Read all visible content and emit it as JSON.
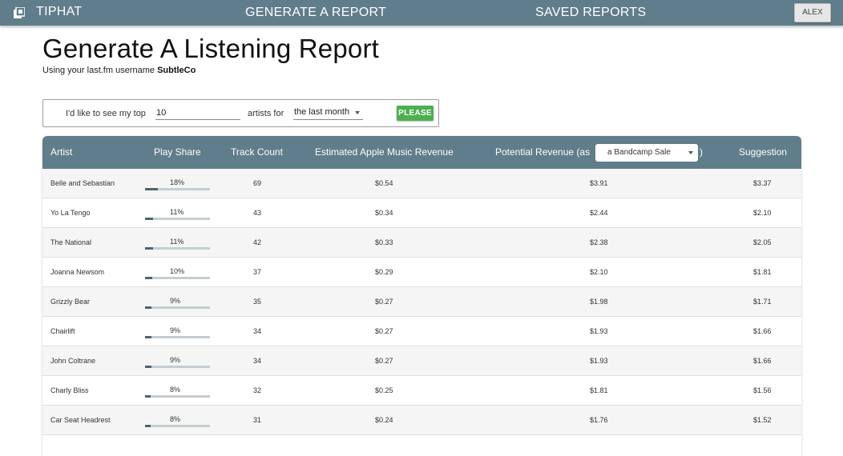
{
  "nav": {
    "brand": "TIPHAT",
    "generate": "GENERATE A REPORT",
    "saved": "SAVED REPORTS",
    "user": "ALEX"
  },
  "page": {
    "title": "Generate A Listening Report",
    "subtitle_prefix": "Using your last.fm username ",
    "username": "SubtleCo"
  },
  "form": {
    "text_before": "I'd like to see my top",
    "count_value": "10",
    "text_middle": "artists for",
    "period_value": "the last month",
    "submit_label": "PLEASE"
  },
  "table": {
    "headers": {
      "artist": "Artist",
      "play_share": "Play Share",
      "track_count": "Track Count",
      "apple_revenue": "Estimated Apple Music Revenue",
      "potential_revenue": "Potential Revenue (as",
      "revenue_mode": "a Bandcamp Sale",
      "paren_close": ")",
      "suggestion": "Suggestion"
    },
    "rows": [
      {
        "artist": "Belle and Sebastian",
        "share": "18%",
        "share_value": 0.18,
        "count": "69",
        "apple": "$0.54",
        "potential": "$3.91",
        "suggestion": "$3.37"
      },
      {
        "artist": "Yo La Tengo",
        "share": "11%",
        "share_value": 0.11,
        "count": "43",
        "apple": "$0.34",
        "potential": "$2.44",
        "suggestion": "$2.10"
      },
      {
        "artist": "The National",
        "share": "11%",
        "share_value": 0.11,
        "count": "42",
        "apple": "$0.33",
        "potential": "$2.38",
        "suggestion": "$2.05"
      },
      {
        "artist": "Joanna Newsom",
        "share": "10%",
        "share_value": 0.1,
        "count": "37",
        "apple": "$0.29",
        "potential": "$2.10",
        "suggestion": "$1.81"
      },
      {
        "artist": "Grizzly Bear",
        "share": "9%",
        "share_value": 0.09,
        "count": "35",
        "apple": "$0.27",
        "potential": "$1.98",
        "suggestion": "$1.71"
      },
      {
        "artist": "Chairlift",
        "share": "9%",
        "share_value": 0.09,
        "count": "34",
        "apple": "$0.27",
        "potential": "$1.93",
        "suggestion": "$1.66"
      },
      {
        "artist": "John Coltrane",
        "share": "9%",
        "share_value": 0.09,
        "count": "34",
        "apple": "$0.27",
        "potential": "$1.93",
        "suggestion": "$1.66"
      },
      {
        "artist": "Charly Bliss",
        "share": "8%",
        "share_value": 0.08,
        "count": "32",
        "apple": "$0.25",
        "potential": "$1.81",
        "suggestion": "$1.56"
      },
      {
        "artist": "Car Seat Headrest",
        "share": "8%",
        "share_value": 0.08,
        "count": "31",
        "apple": "$0.24",
        "potential": "$1.76",
        "suggestion": "$1.52"
      }
    ]
  },
  "colors": {
    "header_bg": "#607d8b",
    "accent_green": "#4caf50",
    "bar_fill": "#4a6572",
    "bar_track": "#c5cdd1"
  }
}
